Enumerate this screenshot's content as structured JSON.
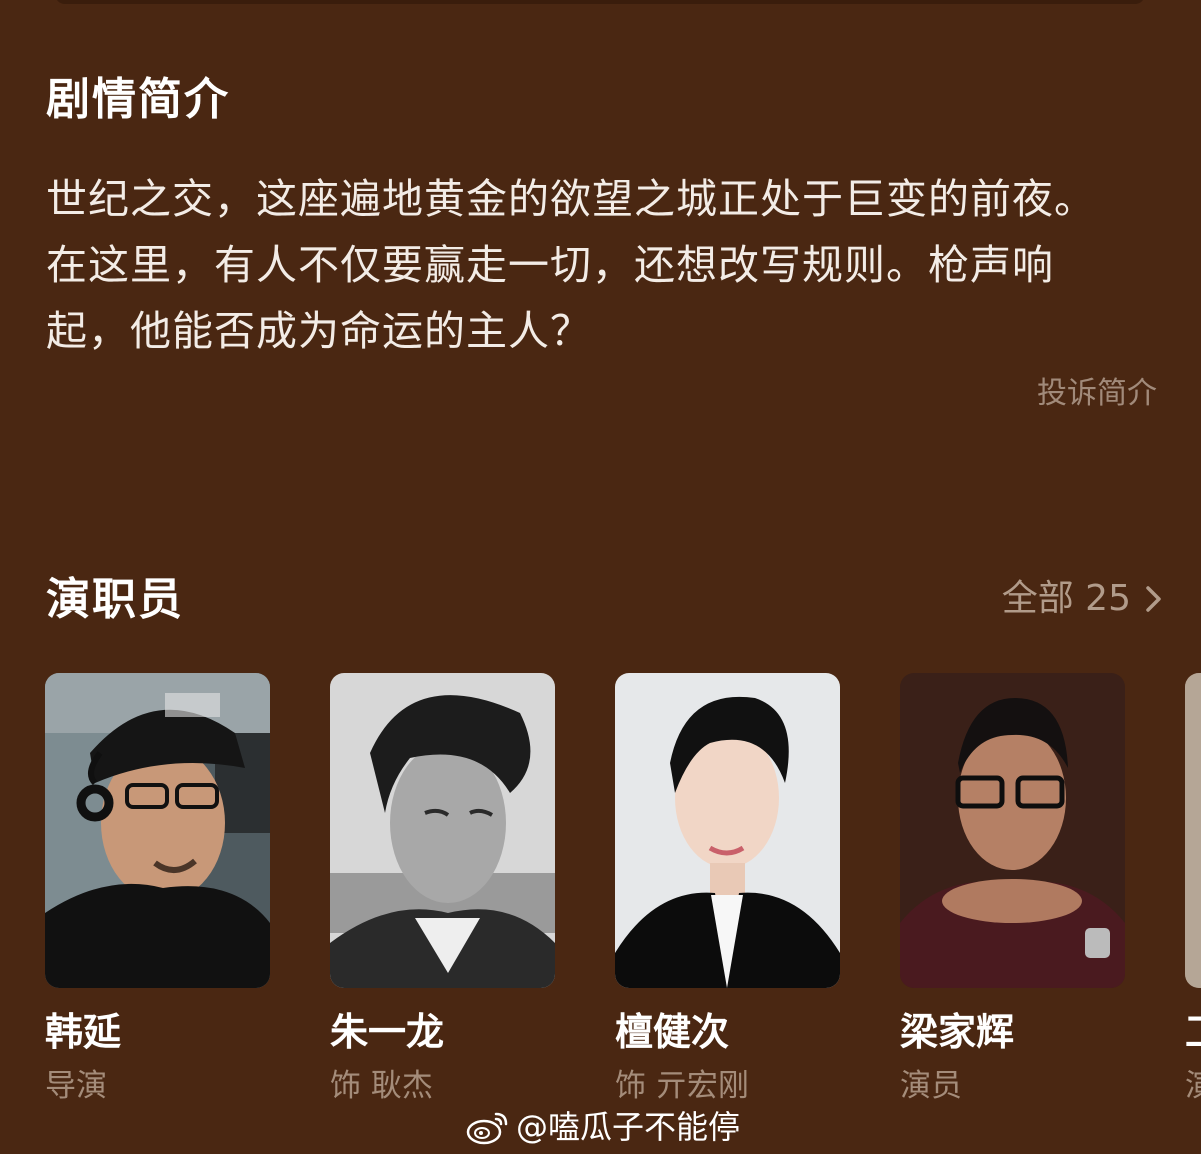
{
  "synopsis": {
    "title": "剧情简介",
    "text": "世纪之交，这座遍地黄金的欲望之城正处于巨变的前夜。在这里，有人不仅要赢走一切，还想改写规则。枪声响起，他能否成为命运的主人？",
    "report_label": "投诉简介"
  },
  "cast": {
    "title": "演职员",
    "all_label": "全部 25",
    "chevron_icon": "chevron-right-icon",
    "members": [
      {
        "name": "韩延",
        "role": "导演"
      },
      {
        "name": "朱一龙",
        "role": "饰 耿杰"
      },
      {
        "name": "檀健次",
        "role": "饰 亓宏刚"
      },
      {
        "name": "梁家辉",
        "role": "演员"
      },
      {
        "name": "工",
        "role": "演"
      }
    ]
  },
  "watermark": {
    "icon": "weibo-icon",
    "text": "@嗑瓜子不能停"
  }
}
